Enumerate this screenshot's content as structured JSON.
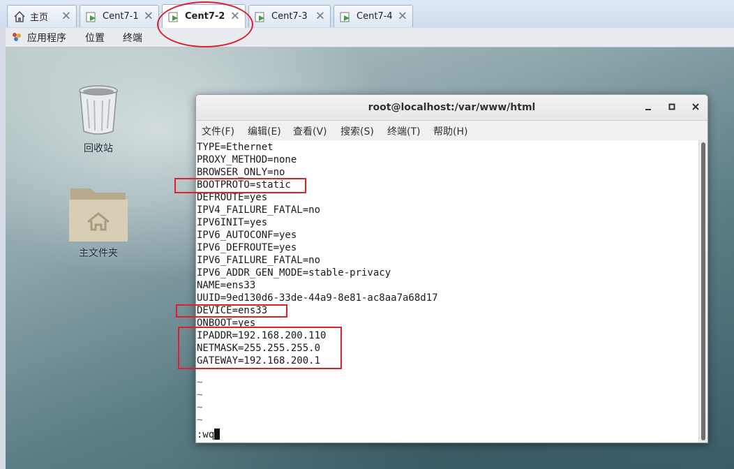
{
  "tabs": [
    {
      "label": "主页",
      "icon": "home-icon",
      "active": false
    },
    {
      "label": "Cent7-1",
      "icon": "vm-icon",
      "active": false
    },
    {
      "label": "Cent7-2",
      "icon": "vm-icon",
      "active": true
    },
    {
      "label": "Cent7-3",
      "icon": "vm-icon",
      "active": false
    },
    {
      "label": "Cent7-4",
      "icon": "vm-icon",
      "active": false
    }
  ],
  "tab_close_glyph": "✕",
  "topbar": {
    "applications": "应用程序",
    "places": "位置",
    "terminal": "终端"
  },
  "desktop": {
    "trash_label": "回收站",
    "home_label": "主文件夹"
  },
  "terminal": {
    "title": "root@localhost:/var/www/html",
    "menu": [
      "文件(F)",
      "编辑(E)",
      "查看(V)",
      "搜索(S)",
      "终端(T)",
      "帮助(H)"
    ],
    "lines": [
      "TYPE=Ethernet",
      "PROXY_METHOD=none",
      "BROWSER_ONLY=no",
      "BOOTPROTO=static",
      "DEFROUTE=yes",
      "IPV4_FAILURE_FATAL=no",
      "IPV6INIT=yes",
      "IPV6_AUTOCONF=yes",
      "IPV6_DEFROUTE=yes",
      "IPV6_FAILURE_FATAL=no",
      "IPV6_ADDR_GEN_MODE=stable-privacy",
      "NAME=ens33",
      "UUID=9ed130d6-33de-44a9-8e81-ac8aa7a68d17",
      "DEVICE=ens33",
      "ONBOOT=yes",
      "IPADDR=192.168.200.110",
      "NETMASK=255.255.255.0",
      "GATEWAY=192.168.200.1",
      "",
      "~",
      "~",
      "~",
      "~"
    ],
    "command": ":wq"
  },
  "colors": {
    "annotation": "#e0202a",
    "tilde": "#4a6aa8"
  }
}
